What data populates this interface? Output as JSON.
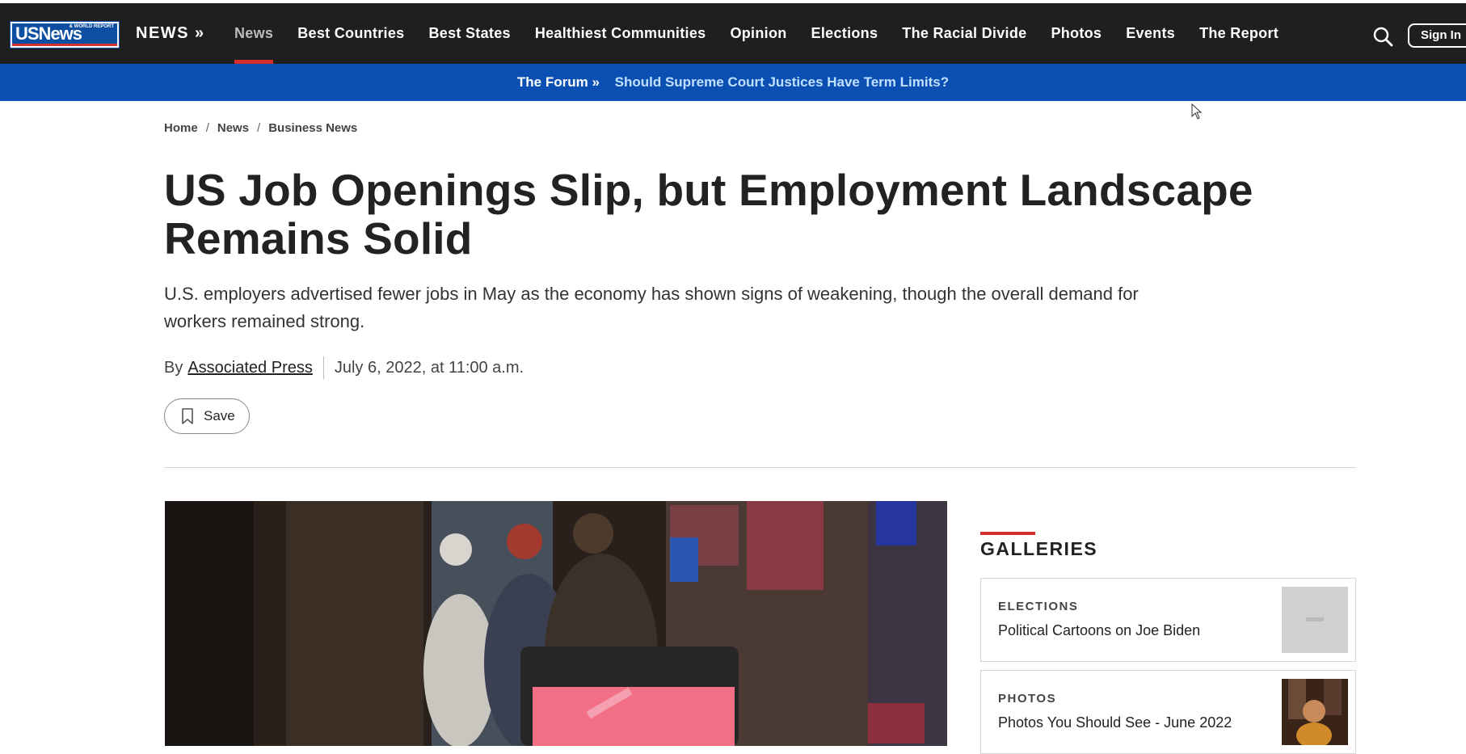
{
  "header": {
    "logo_text": "USNews",
    "logo_small": "& WORLD REPORT",
    "brand": "NEWS »",
    "nav": [
      "News",
      "Best Countries",
      "Best States",
      "Healthiest Communities",
      "Opinion",
      "Elections",
      "The Racial Divide",
      "Photos",
      "Events",
      "The Report"
    ],
    "active_nav": "News",
    "signin_label": "Sign In"
  },
  "forum": {
    "label": "The Forum »",
    "link": "Should Supreme Court Justices Have Term Limits?"
  },
  "breadcrumb": [
    "Home",
    "News",
    "Business News"
  ],
  "article": {
    "headline": "US Job Openings Slip, but Employment Landscape Remains Solid",
    "dek": "U.S. employers advertised fewer jobs in May as the economy has shown signs of weakening, though the overall demand for workers remained strong.",
    "by": "By",
    "author": "Associated Press",
    "date": "July 6, 2022, at 11:00 a.m.",
    "save_label": "Save"
  },
  "sidebar": {
    "title": "GALLERIES",
    "items": [
      {
        "category": "ELECTIONS",
        "title": "Political Cartoons on Joe Biden"
      },
      {
        "category": "PHOTOS",
        "title": "Photos You Should See - June 2022"
      }
    ]
  },
  "colors": {
    "nav_bg": "#1f1f1f",
    "forum_bg": "#0b4fb3",
    "accent_red": "#d32f2f"
  }
}
